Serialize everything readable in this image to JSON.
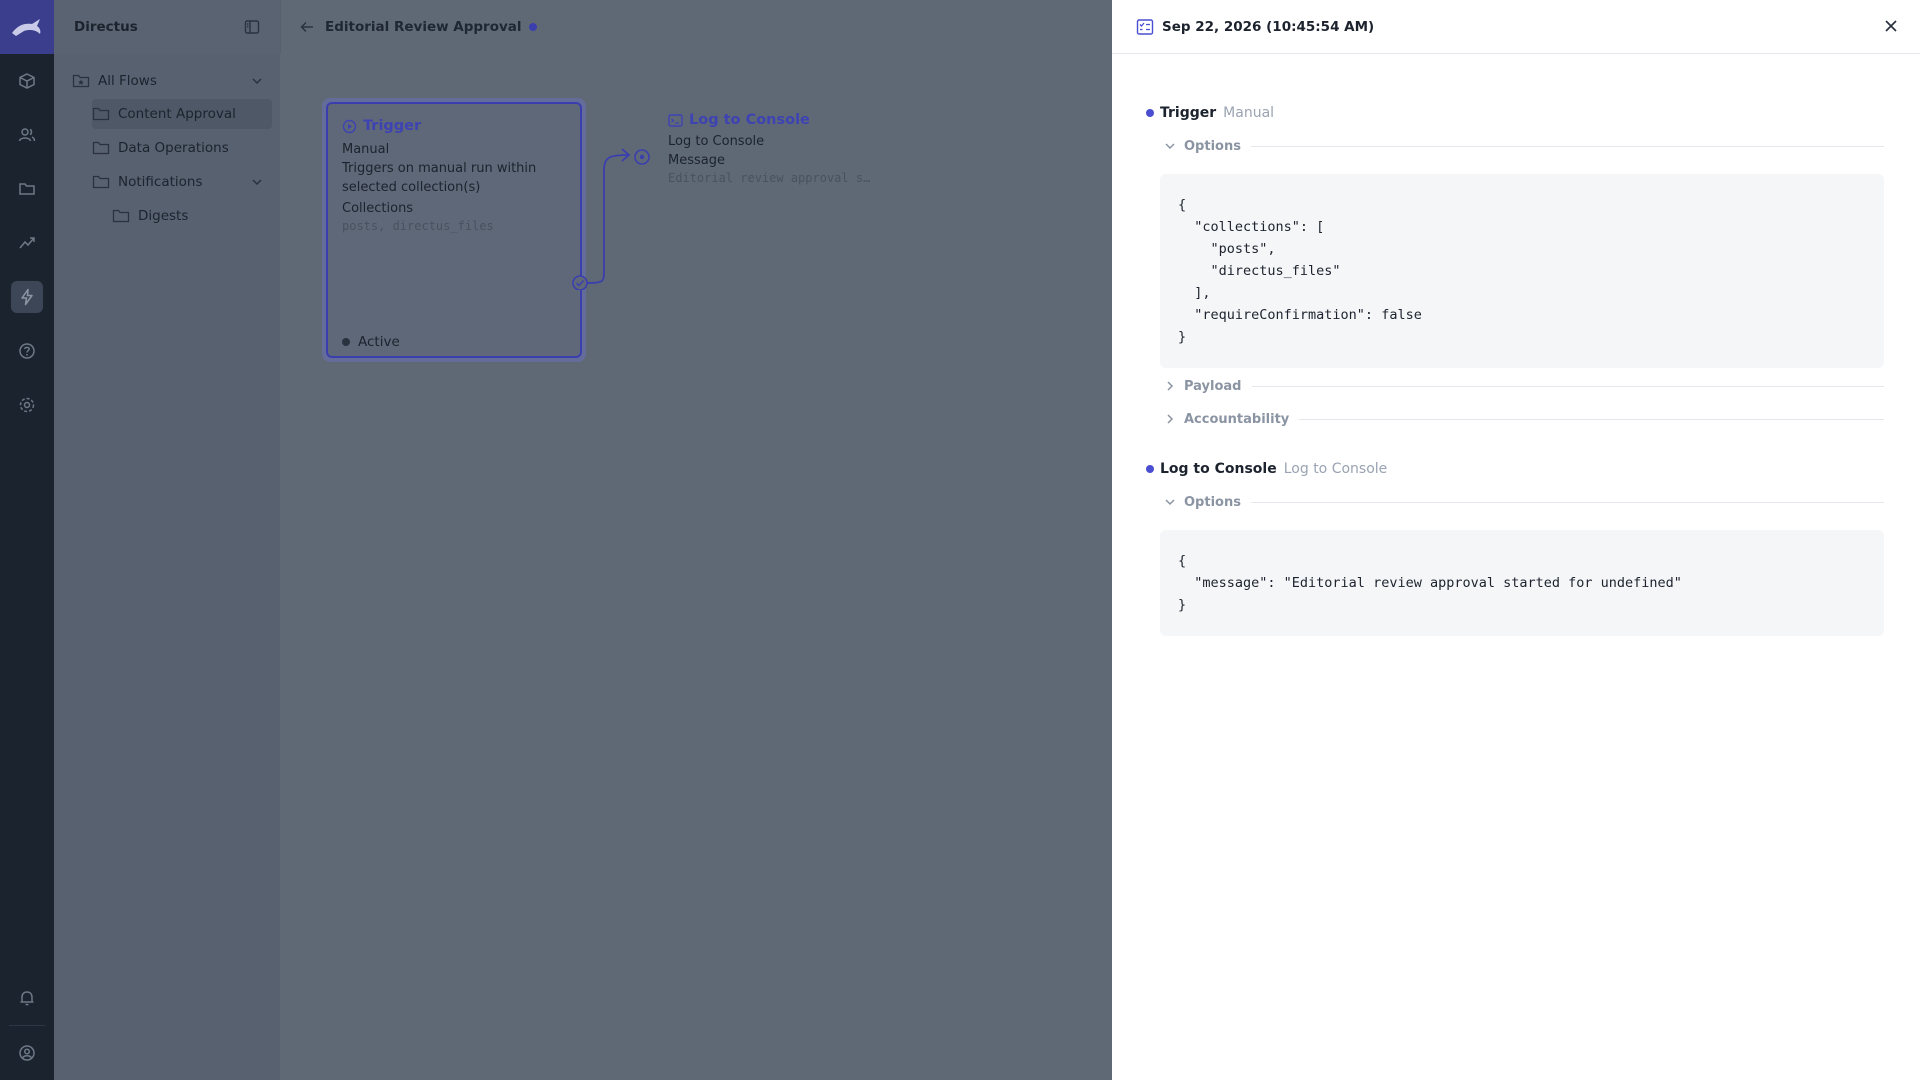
{
  "app": {
    "name": "Directus"
  },
  "nav": {
    "items": [
      {
        "label": "All Flows",
        "expanded": true
      },
      {
        "label": "Content Approval"
      },
      {
        "label": "Data Operations"
      },
      {
        "label": "Notifications",
        "expanded": true
      },
      {
        "label": "Digests"
      }
    ]
  },
  "header": {
    "title": "Editorial Review Approval"
  },
  "flow": {
    "trigger": {
      "title": "Trigger",
      "type": "Manual",
      "description": "Triggers on manual run within selected collection(s)",
      "collections_label": "Collections",
      "collections_value": "posts, directus_files",
      "status": "Active"
    },
    "operation": {
      "title": "Log to Console",
      "subtitle": "Log to Console",
      "message_label": "Message",
      "message_value": "Editorial review approval s…"
    }
  },
  "drawer": {
    "date": "Sep 22, 2026 (10:45:54 AM)",
    "steps": [
      {
        "name": "Trigger",
        "kind": "Manual",
        "options_label": "Options",
        "options_json": "{\n  \"collections\": [\n    \"posts\",\n    \"directus_files\"\n  ],\n  \"requireConfirmation\": false\n}",
        "payload_label": "Payload",
        "accountability_label": "Accountability"
      },
      {
        "name": "Log to Console",
        "kind": "Log to Console",
        "options_label": "Options",
        "options_json": "{\n  \"message\": \"Editorial review approval started for undefined\"\n}"
      }
    ]
  },
  "colors": {
    "accent": "#4a4fd1",
    "overlay": "#5f6875",
    "modbar": "#1b232f"
  }
}
